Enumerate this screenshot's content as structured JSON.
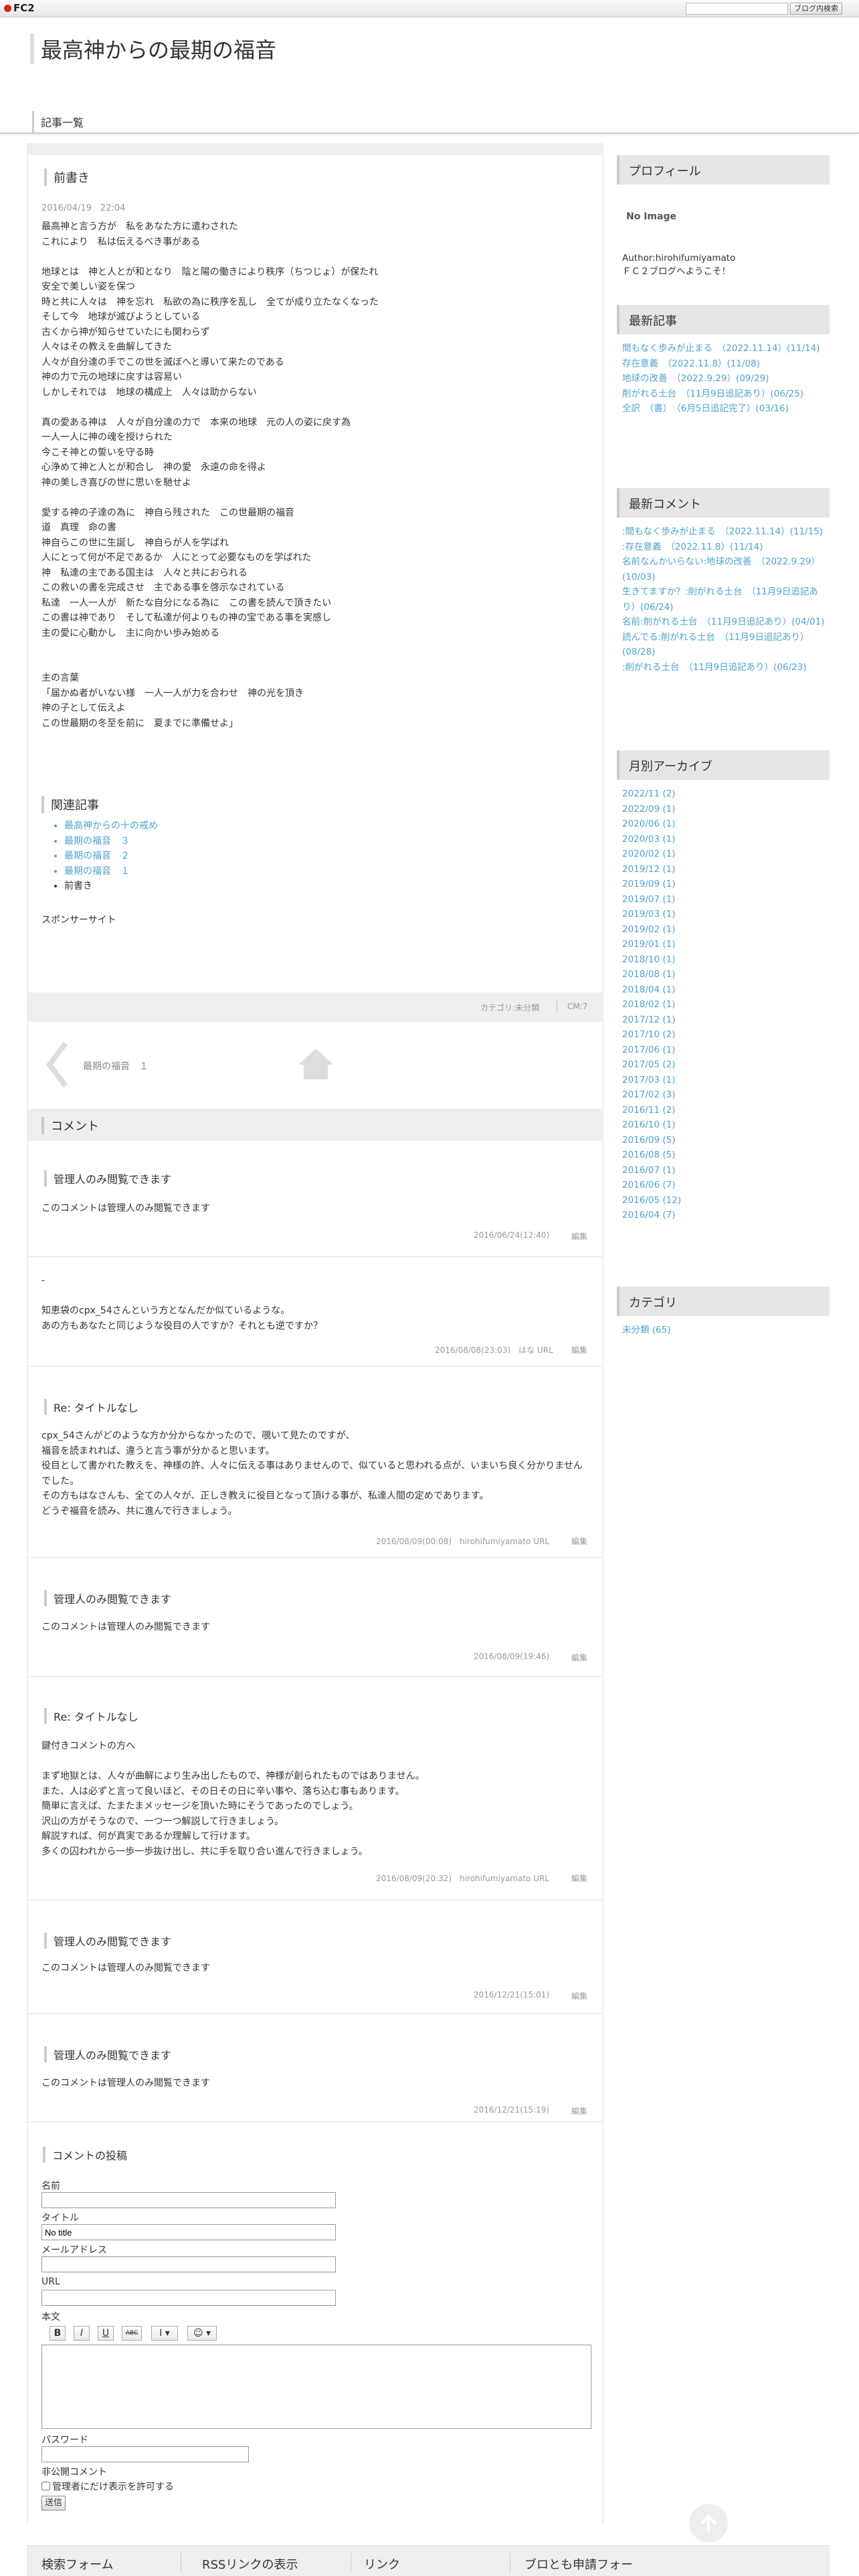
{
  "fc2": {
    "logo": "FC2",
    "search_placeholder": "",
    "button": "ブログ内検索"
  },
  "blog": {
    "title": "最高神からの最期の福音"
  },
  "nav": {
    "article_list": "記事一覧"
  },
  "post": {
    "title": "前書き",
    "date": "2016/04/19　22:04",
    "body": "最高神と言う方が　私をあなた方に遣わされた\nこれにより　私は伝えるべき事がある\n\n地球とは　神と人とが和となり　陰と陽の働きにより秩序（ちつじょ）が保たれ\n安全で美しい姿を保つ\n時と共に人々は　神を忘れ　私欲の為に秩序を乱し　全てが成り立たなくなった\nそして今　地球が滅びようとしている\n古くから神が知らせていたにも関わらず\n人々はその教えを曲解してきた\n人々が自分達の手でこの世を滅ぼへと導いて来たのである\n神の力で元の地球に戻すは容易い\nしかしそれでは　地球の構成上　人々は助からない\n\n真の愛ある神は　人々が自分達の力で　本来の地球　元の人の姿に戻す為\n一人一人に神の魂を授けられた\n今こそ神との誓いを守る時\n心浄めて神と人とが和合し　神の愛　永遠の命を得よ\n神の美しき喜びの世に思いを馳せよ\n\n愛する神の子達の為に　神自ら残された　この世最期の福音\n道　真理　命の書\n神自らこの世に生誕し　神自らが人を学ばれ\n人にとって何が不足であるか　人にとって必要なものを学ばれた\n神　私達の主である国主は　人々と共におられる\nこの救いの書を完成させ　主である事を啓示なされている\n私達　一人一人が　新たな自分になる為に　この書を読んで頂きたい\nこの書は神であり　そして私達が何よりもの神の宝である事を実感し\n主の愛に心動かし　主に向かい歩み始める\n\n\n主の言葉\n「届かぬ者がいない様　一人一人が力を合わせ　神の光を頂き\n神の子として伝えよ\nこの世最期の冬至を前に　夏までに準備せよ」",
    "related_title": "関連記事",
    "related": [
      "最高神からの十の戒め",
      "最期の福音　３",
      "最期の福音　２",
      "最期の福音　１",
      "前書き"
    ],
    "sponsor": "スポンサーサイト",
    "category_meta": "カテゴリ:未分類",
    "cm": "CM:7",
    "prev_link": "最期の福音　１"
  },
  "comments_heading": "コメント",
  "comments": [
    {
      "title": "管理人のみ閲覧できます",
      "body": "このコメントは管理人のみ閲覧できます",
      "meta": "2016/06/24(12:40)",
      "edit": "編集"
    },
    {
      "title": "",
      "body": "-\n\n知恵袋のcpx_54さんという方となんだか似ているような。\nあの方もあなたと同じような役目の人ですか？それとも逆ですか？",
      "meta": "2016/08/08(23:03)　はな URL",
      "edit": "編集"
    },
    {
      "title": "Re: タイトルなし",
      "body": "cpx_54さんがどのような方か分からなかったので、覗いて見たのですが、\n福音を読まれれば、違うと言う事が分かると思います。\n役目として書かれた教えを、神様の許、人々に伝える事はありませんので、似ていると思われる点が、いまいち良く分かりませんでした。\nその方もはなさんも、全ての人々が、正しき教えに役目となって頂ける事が、私達人間の定めであります。\nどうぞ福音を読み、共に進んで行きましょう。",
      "meta": "2016/08/09(00:08)　hirohifumiyamato URL",
      "edit": "編集"
    },
    {
      "title": "管理人のみ閲覧できます",
      "body": "このコメントは管理人のみ閲覧できます",
      "meta": "2016/08/09(19:46)",
      "edit": "編集"
    },
    {
      "title": "Re: タイトルなし",
      "body": "鍵付きコメントの方へ\n\nまず地獄とは、人々が曲解により生み出したもので、神様が創られたものではありません。\nまた、人は必ずと言って良いほど、その日その日に辛い事や、落ち込む事もあります。\n簡単に言えば、たまたまメッセージを頂いた時にそうであったのでしょう。\n沢山の方がそうなので、一つ一つ解説して行きましょう。\n解説すれば、何が真実であるか理解して行けます。\n多くの囚われから一歩一歩抜け出し、共に手を取り合い進んで行きましょう。",
      "meta": "2016/08/09(20:32)　hirohifumiyamato URL",
      "edit": "編集"
    },
    {
      "title": "管理人のみ閲覧できます",
      "body": "このコメントは管理人のみ閲覧できます",
      "meta": "2016/12/21(15:01)",
      "edit": "編集"
    },
    {
      "title": "管理人のみ閲覧できます",
      "body": "このコメントは管理人のみ閲覧できます",
      "meta": "2016/12/21(15:19)",
      "edit": "編集"
    }
  ],
  "form": {
    "heading": "コメントの投稿",
    "name_label": "名前",
    "title_label": "タイトル",
    "title_value": "No title",
    "mail_label": "メールアドレス",
    "url_label": "URL",
    "body_label": "本文",
    "toolbar": [
      "B",
      "I",
      "U",
      "ABC",
      "I ▾",
      "☺ ▾"
    ],
    "password_label": "パスワード",
    "private_label": "非公開コメント",
    "private_checkbox": "管理者にだけ表示を許可する",
    "submit": "送信"
  },
  "sidebar": {
    "profile": {
      "heading": "プロフィール",
      "no_image": "No Image",
      "author": "Author:hirohifumiyamato",
      "welcome": "ＦＣ２ブログへようこそ！"
    },
    "recent_posts": {
      "heading": "最新記事",
      "items": [
        "間もなく歩みが止まる　（2022.11.14）(11/14)",
        "存在意義　（2022.11.8）(11/08)",
        "地球の改善　（2022.9.29）(09/29)",
        "削がれる土台　（11月9日追記あり）(06/25)",
        "全訳　（書）　（6月5日追記完了）(03/16)"
      ]
    },
    "recent_comments": {
      "heading": "最新コメント",
      "items": [
        ":間もなく歩みが止まる　（2022.11.14）(11/15)",
        ":存在意義　（2022.11.8）(11/14)",
        "名前なんかいらない:地球の改善　（2022.9.29）(10/03)",
        "生きてますか？:削がれる土台　（11月9日追記あり）(06/24)",
        "名前:削がれる土台　（11月9日追記あり）(04/01)",
        "読んでる:削がれる土台　（11月9日追記あり）(08/28)",
        ":削がれる土台　（11月9日追記あり）(06/23)"
      ]
    },
    "archive": {
      "heading": "月別アーカイブ",
      "items": [
        "2022/11 (2)",
        "2022/09 (1)",
        "2020/06 (1)",
        "2020/03 (1)",
        "2020/02 (1)",
        "2019/12 (1)",
        "2019/09 (1)",
        "2019/07 (1)",
        "2019/03 (1)",
        "2019/02 (1)",
        "2019/01 (1)",
        "2018/10 (1)",
        "2018/08 (1)",
        "2018/04 (1)",
        "2018/02 (1)",
        "2017/12 (1)",
        "2017/10 (2)",
        "2017/06 (1)",
        "2017/05 (2)",
        "2017/03 (1)",
        "2017/02 (3)",
        "2016/11 (2)",
        "2016/10 (1)",
        "2016/09 (5)",
        "2016/08 (5)",
        "2016/07 (1)",
        "2016/06 (7)",
        "2016/05 (12)",
        "2016/04 (7)"
      ]
    },
    "category": {
      "heading": "カテゴリ",
      "items": [
        "未分類 (65)"
      ]
    }
  },
  "footer": {
    "search": "検索フォーム",
    "rss": "RSSリンクの表示",
    "link": "リンク",
    "friend": "ブロとも申請フォー"
  }
}
